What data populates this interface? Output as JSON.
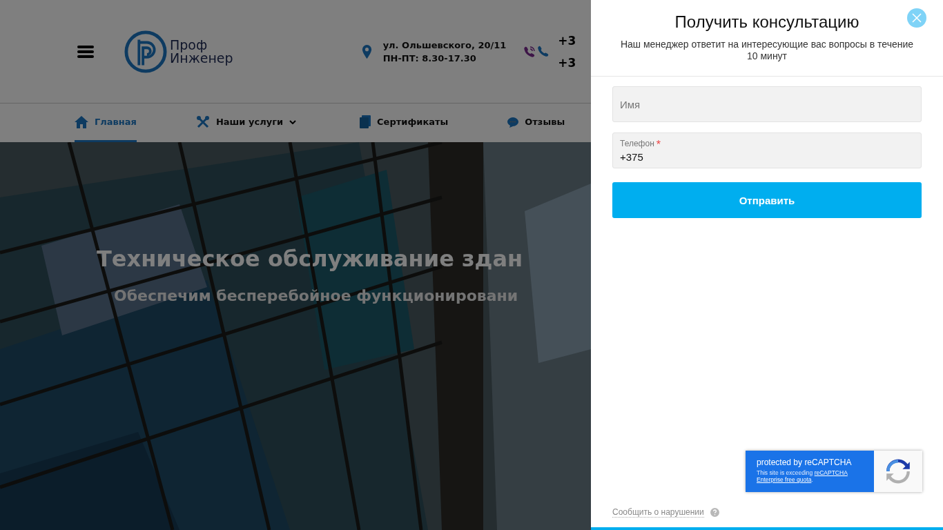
{
  "header": {
    "logo_text": [
      "Проф",
      "Инженер"
    ],
    "address": "ул. Ольшевского, 20/11",
    "hours": "ПН-ПТ: 8.30-17.30",
    "phones": [
      "+3",
      "+3"
    ]
  },
  "nav": [
    {
      "label": "Главная",
      "selected": true,
      "dropdown": false
    },
    {
      "label": "Наши услуги",
      "selected": false,
      "dropdown": true
    },
    {
      "label": "Сертификаты",
      "selected": false,
      "dropdown": false
    },
    {
      "label": "Отзывы",
      "selected": false,
      "dropdown": false
    }
  ],
  "hero": {
    "kind": "picture",
    "title": "Техническое обслуживание здан",
    "subtitle": "Обеспечим бесперебойное функционировани"
  },
  "drawer": {
    "title": "Получить консультацию",
    "subtitle": "Наш менеджер ответит на интересующие вас вопросы в течение 10 минут",
    "fields": [
      {
        "placeholder": "Имя"
      },
      {
        "label": "Телефон",
        "required_mark": "*",
        "value": "+375"
      }
    ],
    "submit": "Отправить",
    "recaptcha": {
      "title": "protected by reCAPTCHA",
      "note": "This site is exceeding ",
      "link_lines": [
        "reCAPTCHA",
        "Enterprise free quota"
      ],
      "end": "."
    },
    "report_link": "Сообщить о нарушении"
  }
}
